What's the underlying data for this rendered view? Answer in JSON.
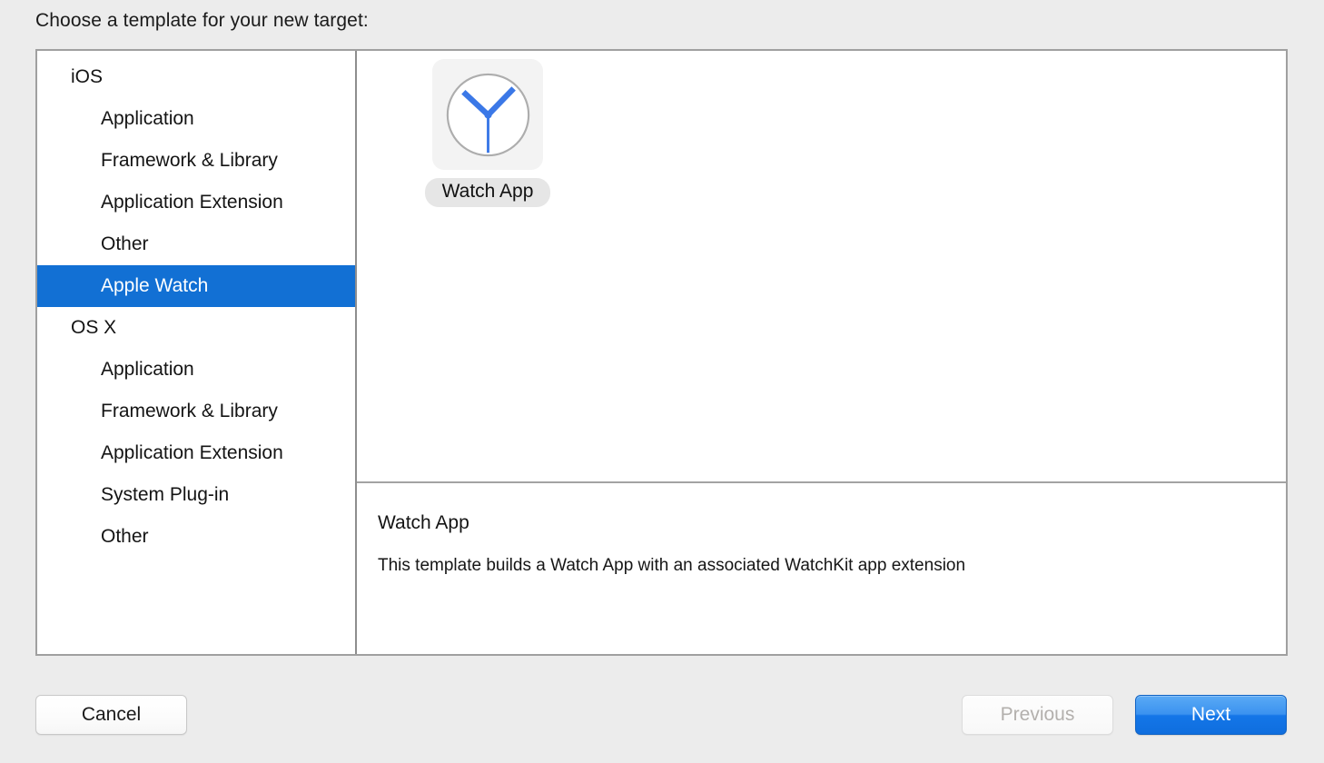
{
  "dialog": {
    "prompt": "Choose a template for your new target:"
  },
  "sidebar": {
    "groups": [
      {
        "header": "iOS",
        "items": [
          {
            "label": "Application",
            "selected": false
          },
          {
            "label": "Framework & Library",
            "selected": false
          },
          {
            "label": "Application Extension",
            "selected": false
          },
          {
            "label": "Other",
            "selected": false
          },
          {
            "label": "Apple Watch",
            "selected": true
          }
        ]
      },
      {
        "header": "OS X",
        "items": [
          {
            "label": "Application",
            "selected": false
          },
          {
            "label": "Framework & Library",
            "selected": false
          },
          {
            "label": "Application Extension",
            "selected": false
          },
          {
            "label": "System Plug-in",
            "selected": false
          },
          {
            "label": "Other",
            "selected": false
          }
        ]
      }
    ]
  },
  "templates": {
    "items": [
      {
        "label": "Watch App",
        "icon": "clock-icon",
        "selected": true
      }
    ]
  },
  "description": {
    "title": "Watch App",
    "body": "This template builds a Watch App with an associated WatchKit app extension"
  },
  "footer": {
    "cancel_label": "Cancel",
    "previous_label": "Previous",
    "next_label": "Next"
  },
  "colors": {
    "selection_blue": "#1270d4",
    "next_button_blue": "#1476e8",
    "clock_hand_blue": "#3b78e7",
    "panel_border": "#a0a0a0",
    "window_background": "#ececec"
  }
}
